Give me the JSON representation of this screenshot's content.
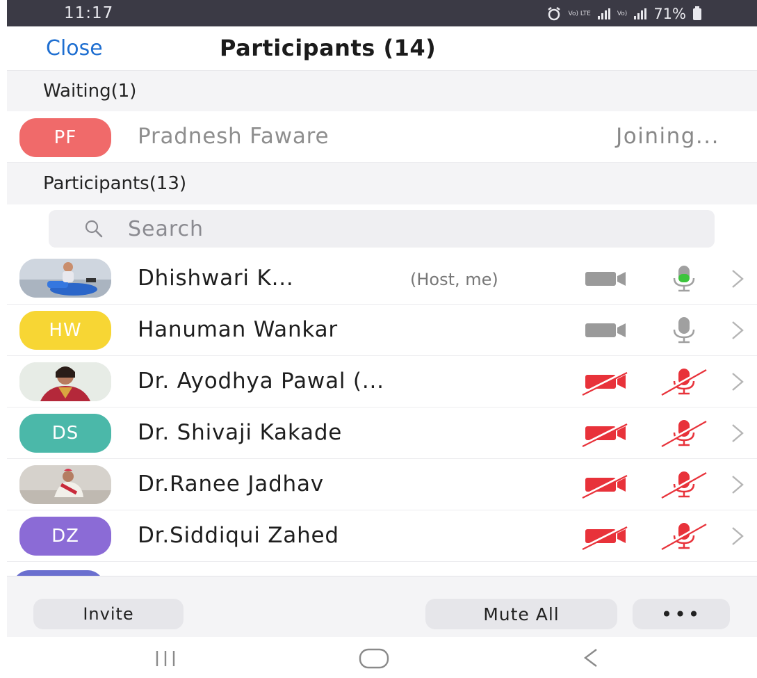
{
  "status_bar": {
    "time": "11:17",
    "network_1": "Vo) LTE",
    "network_2": "Vo)",
    "battery": "71%"
  },
  "header": {
    "close_label": "Close",
    "title": "Participants (14)"
  },
  "waiting": {
    "heading": "Waiting(1)",
    "items": [
      {
        "initials": "PF",
        "name": "Pradnesh Faware",
        "status": "Joining...",
        "avatar_color": "#f06a6a"
      }
    ]
  },
  "participants": {
    "heading": "Participants(13)",
    "search_placeholder": "Search",
    "items": [
      {
        "name": "Dhishwari K...",
        "role": "(Host, me)",
        "avatar": "photo",
        "video": "off-gray",
        "mic": "on-green"
      },
      {
        "initials": "HW",
        "name": "Hanuman Wankar",
        "avatar_color": "#f7d634",
        "video": "off-gray",
        "mic": "gray"
      },
      {
        "name": "Dr. Ayodhya Pawal (...",
        "avatar": "photo",
        "video": "muted-red",
        "mic": "muted-red"
      },
      {
        "initials": "DS",
        "name": "Dr. Shivaji Kakade",
        "avatar_color": "#4bb8a9",
        "video": "muted-red",
        "mic": "muted-red"
      },
      {
        "name": "Dr.Ranee Jadhav",
        "avatar": "photo",
        "video": "muted-red",
        "mic": "muted-red"
      },
      {
        "initials": "DZ",
        "name": "Dr.Siddiqui Zahed",
        "avatar_color": "#8b6bd6",
        "video": "muted-red",
        "mic": "muted-red"
      }
    ]
  },
  "bottom": {
    "invite_label": "Invite",
    "mute_all_label": "Mute All",
    "more_label": "•••"
  },
  "colors": {
    "accent": "#1f6fd1",
    "muted_red": "#e8323a",
    "mic_green": "#3cc43c",
    "icon_gray": "#9a9a9a"
  }
}
